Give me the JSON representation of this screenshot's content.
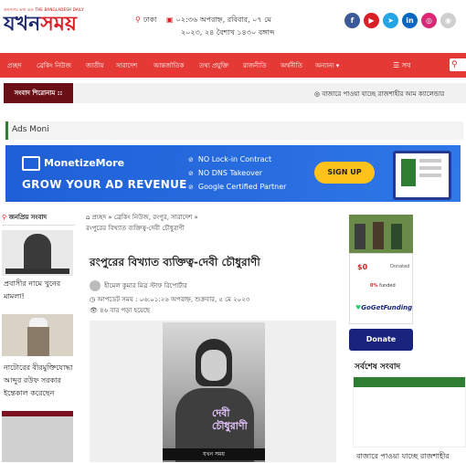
{
  "header": {
    "logo_sub": "জনগণের কথা বলে    THE BANGLADESH DAILY",
    "logo_a": "যখন",
    "logo_b": "সময়",
    "location": "ঢাকা",
    "date_line1": "০২:৩৬ অপরাহ্ন, রবিবার, ০৭ মে",
    "date_line2": "২০২৩, ২৪ বৈশাখ ১৪৩০ বঙ্গাব্দ",
    "social": [
      {
        "name": "facebook-icon",
        "glyph": "f",
        "color": "#3b5998"
      },
      {
        "name": "youtube-icon",
        "glyph": "▶",
        "color": "#d81f26"
      },
      {
        "name": "telegram-icon",
        "glyph": "➤",
        "color": "#26a5e4"
      },
      {
        "name": "linkedin-icon",
        "glyph": "in",
        "color": "#0a66c2"
      },
      {
        "name": "instagram-icon",
        "glyph": "◎",
        "color": "#d62976"
      },
      {
        "name": "rss-icon",
        "glyph": "◉",
        "color": "#cfcfcf"
      }
    ]
  },
  "nav": {
    "items": [
      "প্রচ্ছদ",
      "ব্রেকিং নিউজ",
      "জাতীয়",
      "সারাদেশ",
      "আন্তর্জাতিক",
      "তথ্য প্রযুক্তি",
      "রাজনীতি",
      "অর্থনীতি",
      "অন্যান্য"
    ],
    "more_label": "সব",
    "search_icon": "search-icon"
  },
  "ticker": {
    "label": "সংবাদ শিরোনাম ::",
    "text": "◎ বাজারে পাওয়া যাচ্ছে রাজশাহীর আম ক্যালেন্ডার"
  },
  "ads_moni": {
    "label": "Ads Moni"
  },
  "banner": {
    "brand": "MonetizeMore",
    "headline": "GROW YOUR AD REVENUE",
    "features": [
      "NO Lock-in Contract",
      "NO DNS Takeover",
      "Google Certified Partner"
    ],
    "cta": "SIGN UP"
  },
  "popular": {
    "heading": "জনপ্রিয় সংবাদ",
    "items": [
      {
        "text1": "প্রবাসীর নামে খুনের",
        "text2": "মামলা!"
      },
      {
        "text1": "নাটোরের বীরমুক্তিযোদ্ধা",
        "text2": "আব্দুর রউফ সরকার",
        "text3": "ইন্তেকাল করেছেন"
      }
    ]
  },
  "breadcrumb": {
    "line1": "⌂ প্রচ্ছদ  »  ব্রেকিং নিউজ, রংপুর, সারাদেশ  »",
    "line2": "রংপুরের বিখ্যাত ব্যক্তিত্ব-দেবী চৌধুরাণী"
  },
  "article": {
    "title": "রংপুরের বিখ্যাত ব্যক্তিত্ব-দেবী চৌধুরাণী",
    "author": "হীমেল কুমার মিত্র স্টাফ রিপোর্টার",
    "updated": "◷ আপডেট সময় : ০৬:০১:২৬ অপরাহ্ন, শুক্রবার, ৫ মে ২০২৩",
    "views": "👁 ৪৬ বার পড়া হয়েছে",
    "photo_caption_line1": "দেবী",
    "photo_caption_line2": "চৌধুরাণী",
    "photo_watermark": "যখন সময়"
  },
  "donate": {
    "amount": "$0",
    "amount_label": "Donated",
    "funded": "0%",
    "funded_label": "funded",
    "platform": "GoGetFunding",
    "button": "Donate"
  },
  "latest": {
    "heading": "সর্বশেষ সংবাদ",
    "first_item": "বাজারে পাওয়া যাচ্ছে রাজশাহীর"
  }
}
